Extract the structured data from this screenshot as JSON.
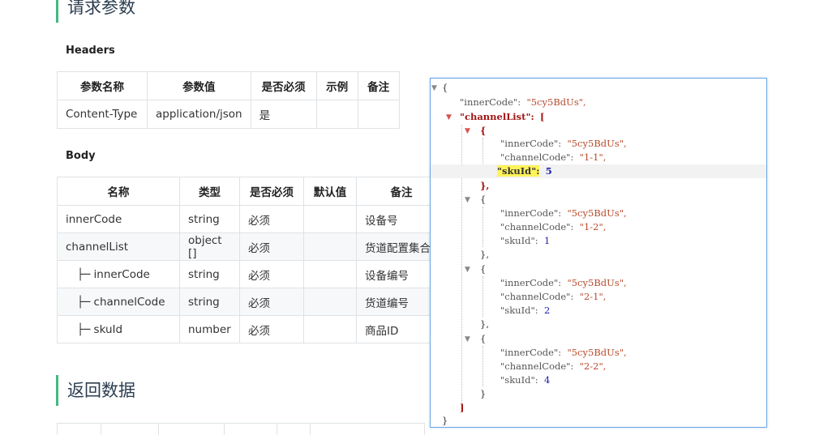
{
  "request_title": "请求参数",
  "response_title": "返回数据",
  "headers": {
    "title": "Headers",
    "columns": [
      "参数名称",
      "参数值",
      "是否必须",
      "示例",
      "备注"
    ],
    "rows": [
      [
        "Content-Type",
        "application/json",
        "是",
        "",
        ""
      ]
    ]
  },
  "body": {
    "title": "Body",
    "columns": [
      "名称",
      "类型",
      "是否必须",
      "默认值",
      "备注"
    ],
    "rows": [
      [
        "innerCode",
        "string",
        "必须",
        "",
        "设备号"
      ],
      [
        "channelList",
        "object []",
        "必须",
        "",
        "货道配置集合"
      ],
      [
        "├─ innerCode",
        "string",
        "必须",
        "",
        "设备编号"
      ],
      [
        "├─ channelCode",
        "string",
        "必须",
        "",
        "货道编号"
      ],
      [
        "├─ skuId",
        "number",
        "必须",
        "",
        "商品ID"
      ]
    ]
  },
  "json": {
    "open_brace": "{",
    "close_brace": "}",
    "open_bracket": "[",
    "close_bracket": "]",
    "comma": ",",
    "item_open": "{",
    "item_close": "},",
    "item_close_last": "}",
    "top_inner_key": "\"innerCode\":",
    "top_inner_val": "\"5cy5BdUs\",",
    "channel_key": "\"channelList\":",
    "items": [
      {
        "inner_key": "\"innerCode\":",
        "inner_val": "\"5cy5BdUs\",",
        "chan_key": "\"channelCode\":",
        "chan_val": "\"1-1\",",
        "sku_key": "\"skuId\":",
        "sku_val": "5"
      },
      {
        "inner_key": "\"innerCode\":",
        "inner_val": "\"5cy5BdUs\",",
        "chan_key": "\"channelCode\":",
        "chan_val": "\"1-2\",",
        "sku_key": "\"skuId\":",
        "sku_val": "1"
      },
      {
        "inner_key": "\"innerCode\":",
        "inner_val": "\"5cy5BdUs\",",
        "chan_key": "\"channelCode\":",
        "chan_val": "\"2-1\",",
        "sku_key": "\"skuId\":",
        "sku_val": "2"
      },
      {
        "inner_key": "\"innerCode\":",
        "inner_val": "\"5cy5BdUs\",",
        "chan_key": "\"channelCode\":",
        "chan_val": "\"2-2\",",
        "sku_key": "\"skuId\":",
        "sku_val": "4"
      }
    ]
  }
}
